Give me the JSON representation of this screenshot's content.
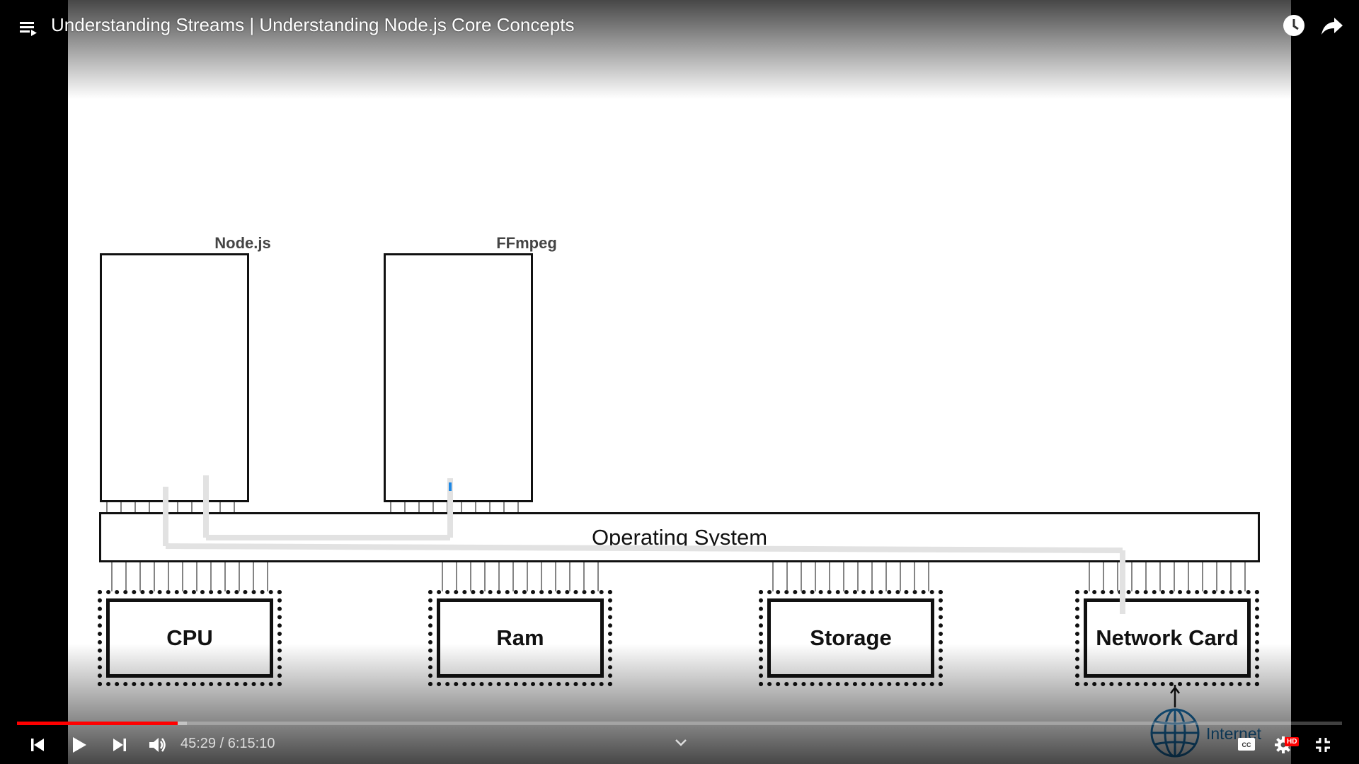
{
  "video": {
    "title": "Understanding Streams | Understanding Node.js Core Concepts",
    "current_time": "45:29",
    "separator": "/",
    "duration": "6:15:10",
    "progress_fraction": 0.121,
    "buffer_fraction": 0.128,
    "hd_badge": "HD"
  },
  "diagram": {
    "processes": [
      {
        "label": "Node.js"
      },
      {
        "label": "FFmpeg"
      }
    ],
    "os_label": "Operating System",
    "hardware": [
      {
        "label": "CPU"
      },
      {
        "label": "Ram"
      },
      {
        "label": "Storage"
      },
      {
        "label": "Network Card"
      }
    ],
    "internet_label": "Internet"
  },
  "icons": {
    "playlist": "playlist-icon",
    "watch_later": "clock-icon",
    "share": "share-icon",
    "previous": "previous-icon",
    "play": "play-icon",
    "next": "next-icon",
    "volume": "volume-icon",
    "chevron": "chevron-down-icon",
    "captions": "captions-icon",
    "settings": "gear-icon",
    "exit_fullscreen": "exit-fullscreen-icon",
    "globe": "globe-icon"
  },
  "colors": {
    "progress": "#ff0000",
    "diagram_stroke": "#111111",
    "highlight": "#1e88e5",
    "internet": "#1a75b5"
  }
}
